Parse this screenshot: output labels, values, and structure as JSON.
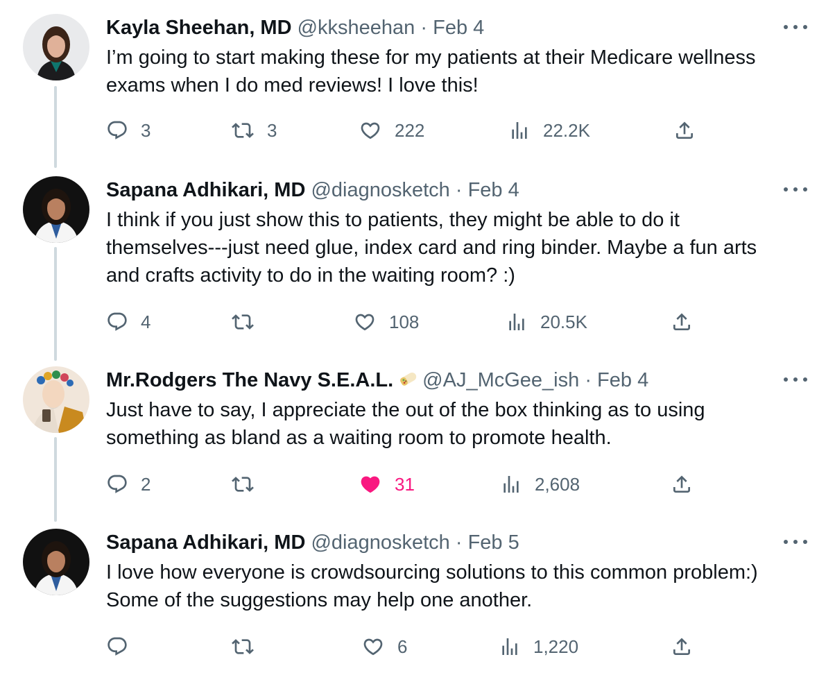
{
  "tweets": [
    {
      "name": "Kayla Sheehan, MD",
      "handle": "@kksheehan",
      "separator": "·",
      "date": "Feb 4",
      "text_lines": [
        "I’m going to start making these for my patients at their Medicare wellness",
        "exams when I do med reviews! I love this!"
      ],
      "replies": "3",
      "retweets": "3",
      "likes": "222",
      "views": "22.2K",
      "liked": false
    },
    {
      "name": "Sapana Adhikari, MD",
      "handle": "@diagnosketch",
      "separator": "·",
      "date": "Feb 4",
      "text_lines": [
        "I think if you just show this to patients, they might be able to do it",
        "themselves---just need glue, index card and ring binder. Maybe a fun arts",
        "and crafts activity to do in the waiting room? :)"
      ],
      "replies": "4",
      "retweets": "",
      "likes": "108",
      "views": "20.5K",
      "liked": false
    },
    {
      "name": "Mr.Rodgers The Navy S.E.A.L.",
      "handle": "@AJ_McGee_ish",
      "separator": "·",
      "date": "Feb 4",
      "text_lines": [
        "Just have to say, I appreciate the out of the box thinking as to using",
        "something as bland as a waiting room to promote health."
      ],
      "replies": "2",
      "retweets": "",
      "likes": "31",
      "views": "2,608",
      "liked": true
    },
    {
      "name": "Sapana Adhikari, MD",
      "handle": "@diagnosketch",
      "separator": "·",
      "date": "Feb 5",
      "text_lines": [
        "I love how everyone is crowdsourcing solutions to this  common problem:)",
        "Some of the suggestions may help one another."
      ],
      "replies": "",
      "retweets": "",
      "likes": "6",
      "views": "1,220",
      "liked": false
    }
  ],
  "icons": {
    "reply": "reply-icon",
    "retweet": "retweet-icon",
    "like": "heart-icon",
    "views": "views-icon",
    "share": "share-icon",
    "more": "more-icon"
  },
  "colors": {
    "text": "#0f1419",
    "secondary": "#536471",
    "like_active": "#f91880",
    "thread_line": "#cfd9de"
  }
}
